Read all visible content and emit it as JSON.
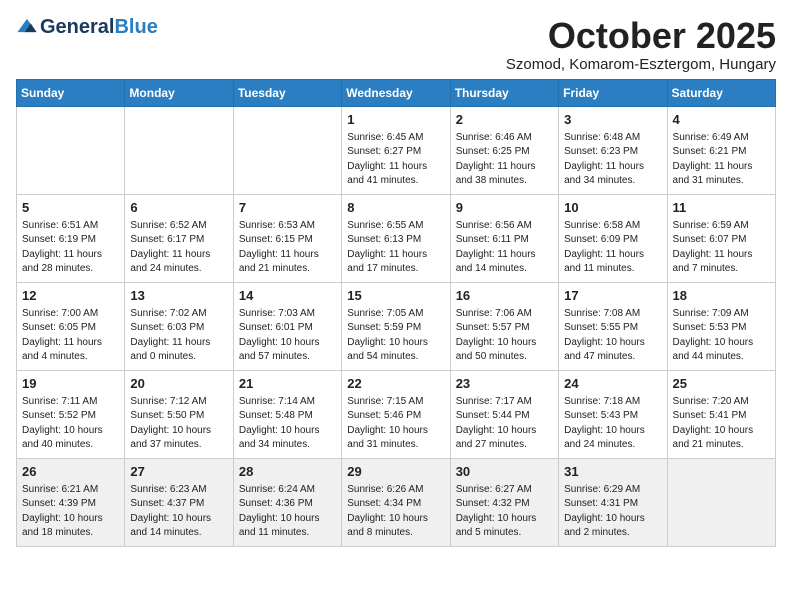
{
  "logo": {
    "general": "General",
    "blue": "Blue"
  },
  "header": {
    "month": "October 2025",
    "location": "Szomod, Komarom-Esztergom, Hungary"
  },
  "days_of_week": [
    "Sunday",
    "Monday",
    "Tuesday",
    "Wednesday",
    "Thursday",
    "Friday",
    "Saturday"
  ],
  "weeks": [
    [
      {
        "day": "",
        "info": ""
      },
      {
        "day": "",
        "info": ""
      },
      {
        "day": "",
        "info": ""
      },
      {
        "day": "1",
        "info": "Sunrise: 6:45 AM\nSunset: 6:27 PM\nDaylight: 11 hours\nand 41 minutes."
      },
      {
        "day": "2",
        "info": "Sunrise: 6:46 AM\nSunset: 6:25 PM\nDaylight: 11 hours\nand 38 minutes."
      },
      {
        "day": "3",
        "info": "Sunrise: 6:48 AM\nSunset: 6:23 PM\nDaylight: 11 hours\nand 34 minutes."
      },
      {
        "day": "4",
        "info": "Sunrise: 6:49 AM\nSunset: 6:21 PM\nDaylight: 11 hours\nand 31 minutes."
      }
    ],
    [
      {
        "day": "5",
        "info": "Sunrise: 6:51 AM\nSunset: 6:19 PM\nDaylight: 11 hours\nand 28 minutes."
      },
      {
        "day": "6",
        "info": "Sunrise: 6:52 AM\nSunset: 6:17 PM\nDaylight: 11 hours\nand 24 minutes."
      },
      {
        "day": "7",
        "info": "Sunrise: 6:53 AM\nSunset: 6:15 PM\nDaylight: 11 hours\nand 21 minutes."
      },
      {
        "day": "8",
        "info": "Sunrise: 6:55 AM\nSunset: 6:13 PM\nDaylight: 11 hours\nand 17 minutes."
      },
      {
        "day": "9",
        "info": "Sunrise: 6:56 AM\nSunset: 6:11 PM\nDaylight: 11 hours\nand 14 minutes."
      },
      {
        "day": "10",
        "info": "Sunrise: 6:58 AM\nSunset: 6:09 PM\nDaylight: 11 hours\nand 11 minutes."
      },
      {
        "day": "11",
        "info": "Sunrise: 6:59 AM\nSunset: 6:07 PM\nDaylight: 11 hours\nand 7 minutes."
      }
    ],
    [
      {
        "day": "12",
        "info": "Sunrise: 7:00 AM\nSunset: 6:05 PM\nDaylight: 11 hours\nand 4 minutes."
      },
      {
        "day": "13",
        "info": "Sunrise: 7:02 AM\nSunset: 6:03 PM\nDaylight: 11 hours\nand 0 minutes."
      },
      {
        "day": "14",
        "info": "Sunrise: 7:03 AM\nSunset: 6:01 PM\nDaylight: 10 hours\nand 57 minutes."
      },
      {
        "day": "15",
        "info": "Sunrise: 7:05 AM\nSunset: 5:59 PM\nDaylight: 10 hours\nand 54 minutes."
      },
      {
        "day": "16",
        "info": "Sunrise: 7:06 AM\nSunset: 5:57 PM\nDaylight: 10 hours\nand 50 minutes."
      },
      {
        "day": "17",
        "info": "Sunrise: 7:08 AM\nSunset: 5:55 PM\nDaylight: 10 hours\nand 47 minutes."
      },
      {
        "day": "18",
        "info": "Sunrise: 7:09 AM\nSunset: 5:53 PM\nDaylight: 10 hours\nand 44 minutes."
      }
    ],
    [
      {
        "day": "19",
        "info": "Sunrise: 7:11 AM\nSunset: 5:52 PM\nDaylight: 10 hours\nand 40 minutes."
      },
      {
        "day": "20",
        "info": "Sunrise: 7:12 AM\nSunset: 5:50 PM\nDaylight: 10 hours\nand 37 minutes."
      },
      {
        "day": "21",
        "info": "Sunrise: 7:14 AM\nSunset: 5:48 PM\nDaylight: 10 hours\nand 34 minutes."
      },
      {
        "day": "22",
        "info": "Sunrise: 7:15 AM\nSunset: 5:46 PM\nDaylight: 10 hours\nand 31 minutes."
      },
      {
        "day": "23",
        "info": "Sunrise: 7:17 AM\nSunset: 5:44 PM\nDaylight: 10 hours\nand 27 minutes."
      },
      {
        "day": "24",
        "info": "Sunrise: 7:18 AM\nSunset: 5:43 PM\nDaylight: 10 hours\nand 24 minutes."
      },
      {
        "day": "25",
        "info": "Sunrise: 7:20 AM\nSunset: 5:41 PM\nDaylight: 10 hours\nand 21 minutes."
      }
    ],
    [
      {
        "day": "26",
        "info": "Sunrise: 6:21 AM\nSunset: 4:39 PM\nDaylight: 10 hours\nand 18 minutes."
      },
      {
        "day": "27",
        "info": "Sunrise: 6:23 AM\nSunset: 4:37 PM\nDaylight: 10 hours\nand 14 minutes."
      },
      {
        "day": "28",
        "info": "Sunrise: 6:24 AM\nSunset: 4:36 PM\nDaylight: 10 hours\nand 11 minutes."
      },
      {
        "day": "29",
        "info": "Sunrise: 6:26 AM\nSunset: 4:34 PM\nDaylight: 10 hours\nand 8 minutes."
      },
      {
        "day": "30",
        "info": "Sunrise: 6:27 AM\nSunset: 4:32 PM\nDaylight: 10 hours\nand 5 minutes."
      },
      {
        "day": "31",
        "info": "Sunrise: 6:29 AM\nSunset: 4:31 PM\nDaylight: 10 hours\nand 2 minutes."
      },
      {
        "day": "",
        "info": ""
      }
    ]
  ]
}
